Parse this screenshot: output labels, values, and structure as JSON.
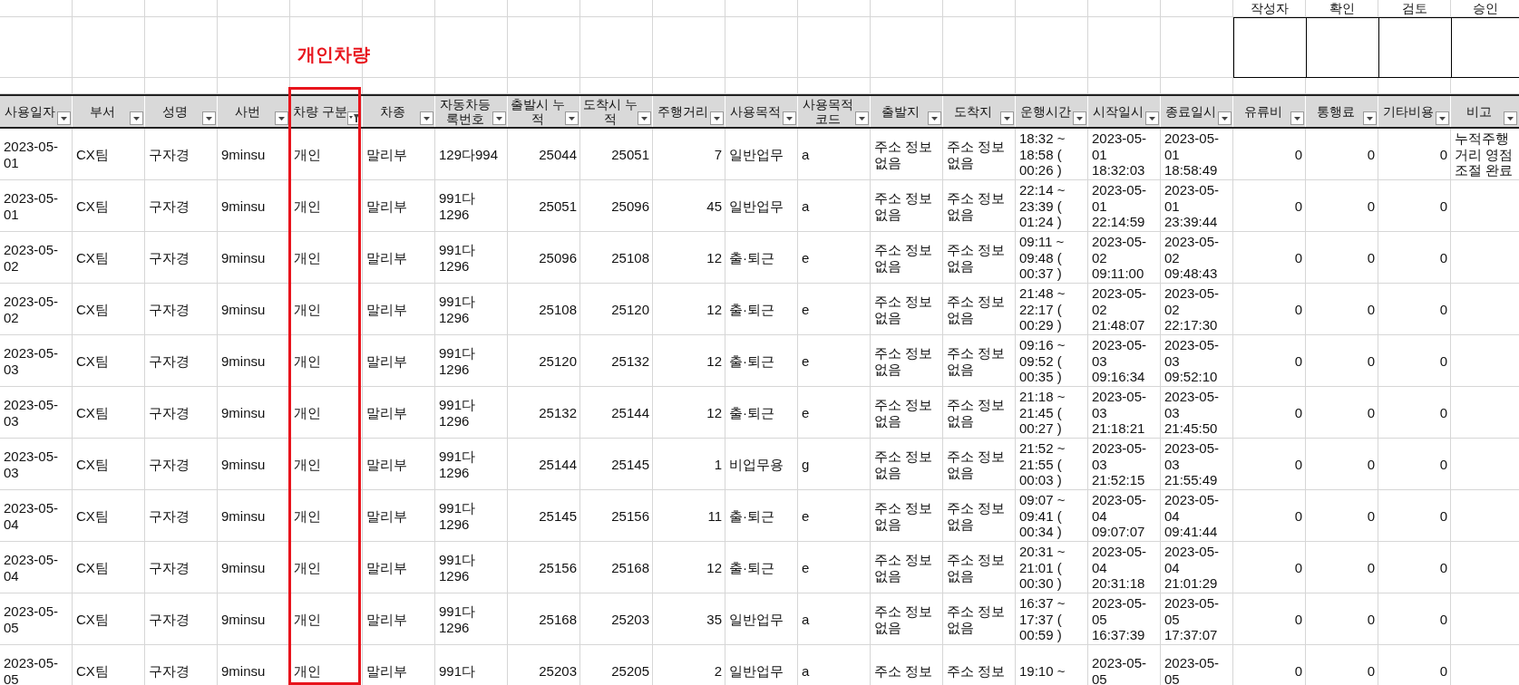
{
  "title": "개인차량",
  "approval": [
    "작성자",
    "확인",
    "검토",
    "승인"
  ],
  "columns": [
    {
      "label": "사용일자",
      "kind": "text",
      "filtered": false,
      "highlighted": false
    },
    {
      "label": "부서",
      "kind": "text",
      "filtered": false,
      "highlighted": false
    },
    {
      "label": "성명",
      "kind": "text",
      "filtered": false,
      "highlighted": false
    },
    {
      "label": "사번",
      "kind": "text",
      "filtered": false,
      "highlighted": false
    },
    {
      "label": "차량 구분",
      "kind": "text",
      "filtered": true,
      "highlighted": true
    },
    {
      "label": "차종",
      "kind": "text",
      "filtered": false,
      "highlighted": false
    },
    {
      "label": "자동차등록번호",
      "kind": "text",
      "filtered": false,
      "highlighted": false
    },
    {
      "label": "출발시 누적",
      "kind": "number",
      "filtered": false,
      "highlighted": false
    },
    {
      "label": "도착시 누적",
      "kind": "number",
      "filtered": false,
      "highlighted": false
    },
    {
      "label": "주행거리",
      "kind": "number",
      "filtered": false,
      "highlighted": false
    },
    {
      "label": "사용목적",
      "kind": "text",
      "filtered": false,
      "highlighted": false
    },
    {
      "label": "사용목적코드",
      "kind": "text",
      "filtered": false,
      "highlighted": false
    },
    {
      "label": "출발지",
      "kind": "text",
      "filtered": false,
      "highlighted": false
    },
    {
      "label": "도착지",
      "kind": "text",
      "filtered": false,
      "highlighted": false
    },
    {
      "label": "운행시간",
      "kind": "text",
      "filtered": false,
      "highlighted": false
    },
    {
      "label": "시작일시",
      "kind": "text",
      "filtered": false,
      "highlighted": false
    },
    {
      "label": "종료일시",
      "kind": "text",
      "filtered": false,
      "highlighted": false
    },
    {
      "label": "유류비",
      "kind": "number",
      "filtered": false,
      "highlighted": false
    },
    {
      "label": "통행료",
      "kind": "number",
      "filtered": false,
      "highlighted": false
    },
    {
      "label": "기타비용",
      "kind": "number",
      "filtered": false,
      "highlighted": false
    },
    {
      "label": "비고",
      "kind": "text",
      "filtered": false,
      "highlighted": false
    }
  ],
  "rows": [
    {
      "cells": [
        "2023-05-01",
        "CX팀",
        "구자경",
        "9minsu",
        "개인",
        "말리부",
        "129다994",
        "25044",
        "25051",
        "7",
        "일반업무",
        "a",
        "주소 정보 없음",
        "주소 정보 없음",
        "18:32 ~ 18:58 ( 00:26 )",
        "2023-05-01 18:32:03",
        "2023-05-01 18:58:49",
        "0",
        "0",
        "0",
        "누적주행거리 영점조절 완료"
      ]
    },
    {
      "cells": [
        "2023-05-01",
        "CX팀",
        "구자경",
        "9minsu",
        "개인",
        "말리부",
        "991다 1296",
        "25051",
        "25096",
        "45",
        "일반업무",
        "a",
        "주소 정보 없음",
        "주소 정보 없음",
        "22:14 ~ 23:39 ( 01:24 )",
        "2023-05-01 22:14:59",
        "2023-05-01 23:39:44",
        "0",
        "0",
        "0"
      ]
    },
    {
      "cells": [
        "2023-05-02",
        "CX팀",
        "구자경",
        "9minsu",
        "개인",
        "말리부",
        "991다 1296",
        "25096",
        "25108",
        "12",
        "출·퇴근",
        "e",
        "주소 정보 없음",
        "주소 정보 없음",
        "09:11 ~ 09:48 ( 00:37 )",
        "2023-05-02 09:11:00",
        "2023-05-02 09:48:43",
        "0",
        "0",
        "0"
      ]
    },
    {
      "cells": [
        "2023-05-02",
        "CX팀",
        "구자경",
        "9minsu",
        "개인",
        "말리부",
        "991다 1296",
        "25108",
        "25120",
        "12",
        "출·퇴근",
        "e",
        "주소 정보 없음",
        "주소 정보 없음",
        "21:48 ~ 22:17 ( 00:29 )",
        "2023-05-02 21:48:07",
        "2023-05-02 22:17:30",
        "0",
        "0",
        "0"
      ]
    },
    {
      "cells": [
        "2023-05-03",
        "CX팀",
        "구자경",
        "9minsu",
        "개인",
        "말리부",
        "991다 1296",
        "25120",
        "25132",
        "12",
        "출·퇴근",
        "e",
        "주소 정보 없음",
        "주소 정보 없음",
        "09:16 ~ 09:52 ( 00:35 )",
        "2023-05-03 09:16:34",
        "2023-05-03 09:52:10",
        "0",
        "0",
        "0"
      ]
    },
    {
      "cells": [
        "2023-05-03",
        "CX팀",
        "구자경",
        "9minsu",
        "개인",
        "말리부",
        "991다 1296",
        "25132",
        "25144",
        "12",
        "출·퇴근",
        "e",
        "주소 정보 없음",
        "주소 정보 없음",
        "21:18 ~ 21:45 ( 00:27 )",
        "2023-05-03 21:18:21",
        "2023-05-03 21:45:50",
        "0",
        "0",
        "0"
      ]
    },
    {
      "cells": [
        "2023-05-03",
        "CX팀",
        "구자경",
        "9minsu",
        "개인",
        "말리부",
        "991다 1296",
        "25144",
        "25145",
        "1",
        "비업무용",
        "g",
        "주소 정보 없음",
        "주소 정보 없음",
        "21:52 ~ 21:55 ( 00:03 )",
        "2023-05-03 21:52:15",
        "2023-05-03 21:55:49",
        "0",
        "0",
        "0"
      ]
    },
    {
      "cells": [
        "2023-05-04",
        "CX팀",
        "구자경",
        "9minsu",
        "개인",
        "말리부",
        "991다 1296",
        "25145",
        "25156",
        "11",
        "출·퇴근",
        "e",
        "주소 정보 없음",
        "주소 정보 없음",
        "09:07 ~ 09:41 ( 00:34 )",
        "2023-05-04 09:07:07",
        "2023-05-04 09:41:44",
        "0",
        "0",
        "0"
      ]
    },
    {
      "cells": [
        "2023-05-04",
        "CX팀",
        "구자경",
        "9minsu",
        "개인",
        "말리부",
        "991다 1296",
        "25156",
        "25168",
        "12",
        "출·퇴근",
        "e",
        "주소 정보 없음",
        "주소 정보 없음",
        "20:31 ~ 21:01 ( 00:30 )",
        "2023-05-04 20:31:18",
        "2023-05-04 21:01:29",
        "0",
        "0",
        "0"
      ]
    },
    {
      "cells": [
        "2023-05-05",
        "CX팀",
        "구자경",
        "9minsu",
        "개인",
        "말리부",
        "991다 1296",
        "25168",
        "25203",
        "35",
        "일반업무",
        "a",
        "주소 정보 없음",
        "주소 정보 없음",
        "16:37 ~ 17:37 ( 00:59 )",
        "2023-05-05 16:37:39",
        "2023-05-05 17:37:07",
        "0",
        "0",
        "0"
      ]
    },
    {
      "cells": [
        "2023-05-05",
        "CX팀",
        "구자경",
        "9minsu",
        "개인",
        "말리부",
        "991다",
        "25203",
        "25205",
        "2",
        "일반업무",
        "a",
        "주소 정보",
        "주소 정보",
        "19:10 ~",
        "2023-05-05",
        "2023-05-05",
        "0",
        "0",
        "0"
      ]
    }
  ]
}
